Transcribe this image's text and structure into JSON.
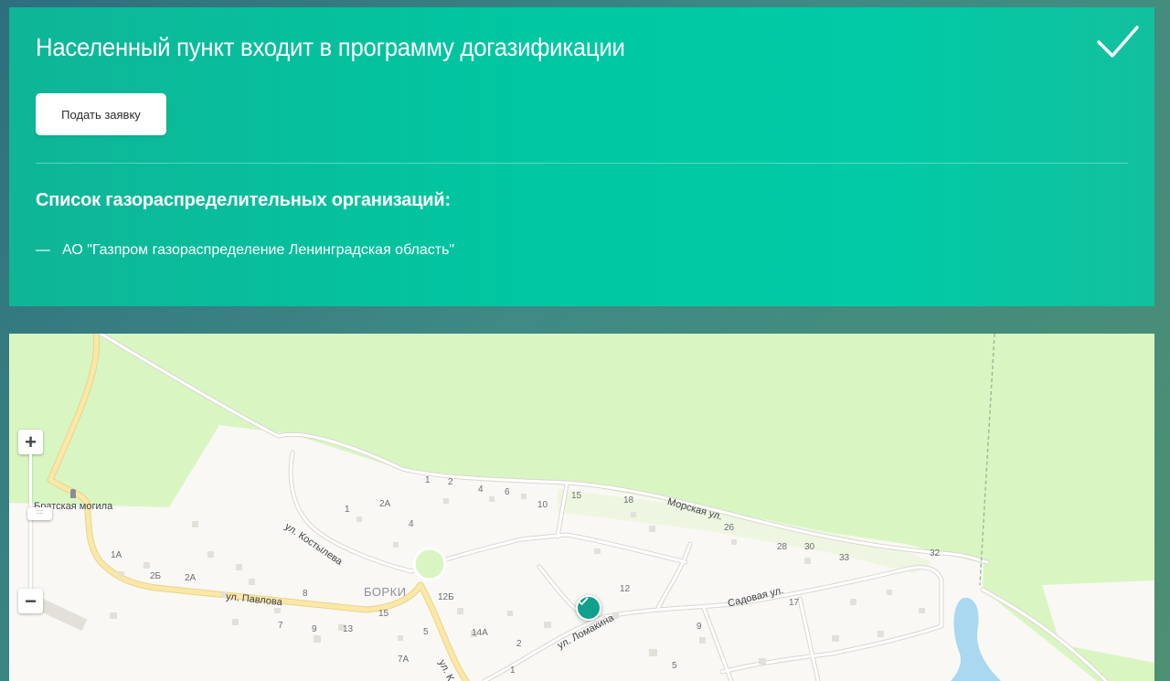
{
  "panel": {
    "title": "Населенный пункт входит в программу догазификации",
    "apply_button_label": "Подать заявку",
    "orgs_title": "Список газораспределительных организаций:",
    "orgs": [
      {
        "dash": "—",
        "name": "АО \"Газпром газораспределение Ленинградская область\""
      }
    ],
    "status_icon": "checkmark-icon"
  },
  "map": {
    "zoom_in_label": "+",
    "zoom_out_label": "−",
    "zoom_handle_label": "::::",
    "place_name": "БОРКИ",
    "landmark": "Братская могила",
    "streets": {
      "kostyleva": "ул. Костылева",
      "pavlova": "ул. Павлова",
      "morskaya": "Морская ул.",
      "sadovaya": "Садовая ул.",
      "lomakina": "ул. Ломакина",
      "k_partial": "ул. К"
    },
    "house_numbers": {
      "h1a": "1",
      "h2a": "2",
      "h4a": "4",
      "h6a": "6",
      "h10": "10",
      "h15a": "15",
      "h18": "18",
      "h26": "26",
      "h28": "28",
      "h30": "30",
      "h33": "33",
      "h32": "32",
      "h1b": "1",
      "h2A": "2А",
      "h4b": "4",
      "h1A": "1А",
      "h2B": "2Б",
      "h2Ab": "2А",
      "h8": "8",
      "h7": "7",
      "h9": "9",
      "h13": "13",
      "h15b": "15",
      "h12B": "12Б",
      "h5a": "5",
      "h14A": "14А",
      "h2b": "2",
      "h7A": "7А",
      "h1c": "1",
      "h12": "12",
      "h17": "17",
      "h9b": "9",
      "h5b": "5"
    },
    "marker_icon": "map-marker-check-icon",
    "colors": {
      "forest": "#d8f5c0",
      "road_major": "#fbe8a8",
      "road_minor": "#ffffff",
      "water": "#a9d8f0",
      "marker": "#10a08d"
    }
  }
}
